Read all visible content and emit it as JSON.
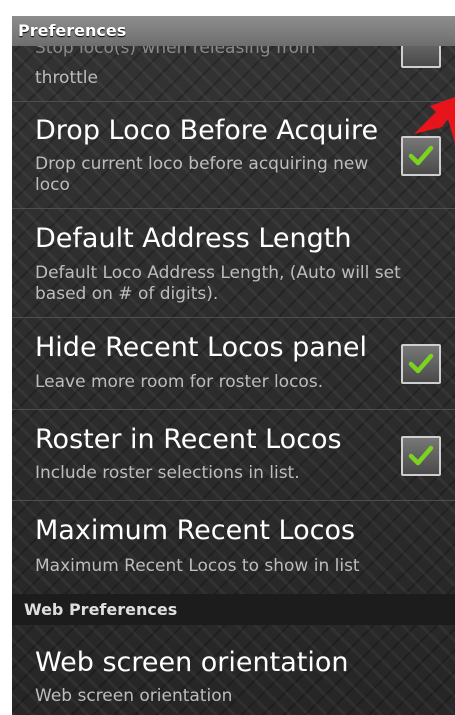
{
  "header": {
    "title": "Preferences"
  },
  "items": [
    {
      "title": "Stop loco(s) when releasing from throttle",
      "summary": "throttle"
    },
    {
      "title": "Drop Loco Before Acquire",
      "summary": "Drop current loco before acquiring new loco",
      "checked": true
    },
    {
      "title": "Default Address Length",
      "summary": "Default Loco Address Length, (Auto will set based on # of digits)."
    },
    {
      "title": "Hide Recent Locos panel",
      "summary": "Leave more room for roster locos.",
      "checked": true
    },
    {
      "title": "Roster in Recent Locos",
      "summary": "Include roster selections in list.",
      "checked": true
    },
    {
      "title": "Maximum Recent Locos",
      "summary": "Maximum Recent Locos to show in list"
    }
  ],
  "section": {
    "title": "Web Preferences"
  },
  "web_items": [
    {
      "title": "Web screen orientation",
      "summary": "Web screen orientation"
    }
  ],
  "colors": {
    "checkmark": "#7ad321",
    "arrow": "#e8141b",
    "title_bar": "#7d7d7d"
  }
}
